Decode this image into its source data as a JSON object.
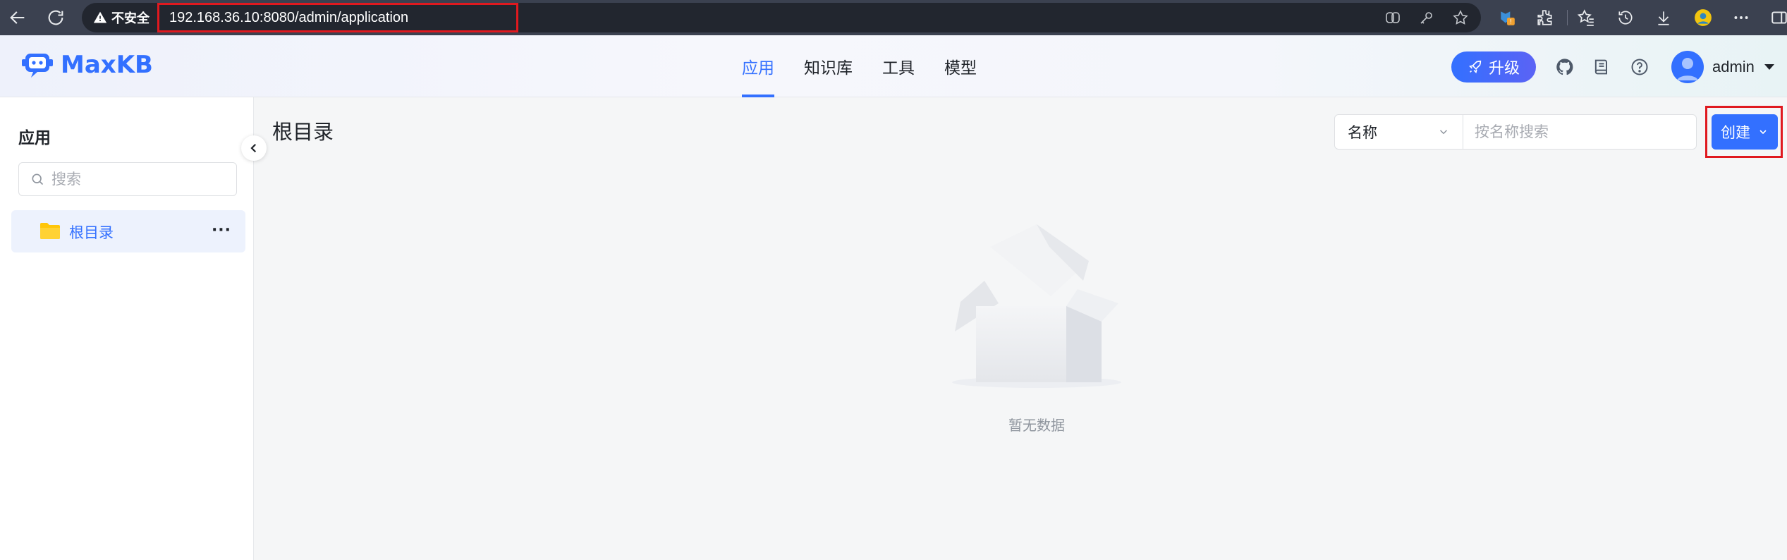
{
  "browser": {
    "security_label": "不安全",
    "url": "192.168.36.10:8080/admin/application"
  },
  "header": {
    "logo_text": "MaxKB",
    "nav": [
      "应用",
      "知识库",
      "工具",
      "模型"
    ],
    "active_nav": "应用",
    "upgrade_label": "升级",
    "username": "admin"
  },
  "sidebar": {
    "title": "应用",
    "search_placeholder": "搜索",
    "tree": [
      {
        "label": "根目录",
        "icon": "folder-icon"
      }
    ],
    "folder_color": "#ffc60a"
  },
  "main": {
    "title": "根目录",
    "filter_select": "名称",
    "search_placeholder": "按名称搜索",
    "create_label": "创建",
    "empty_text": "暂无数据"
  },
  "colors": {
    "accent": "#3370ff",
    "highlight_box": "#e0191f"
  }
}
